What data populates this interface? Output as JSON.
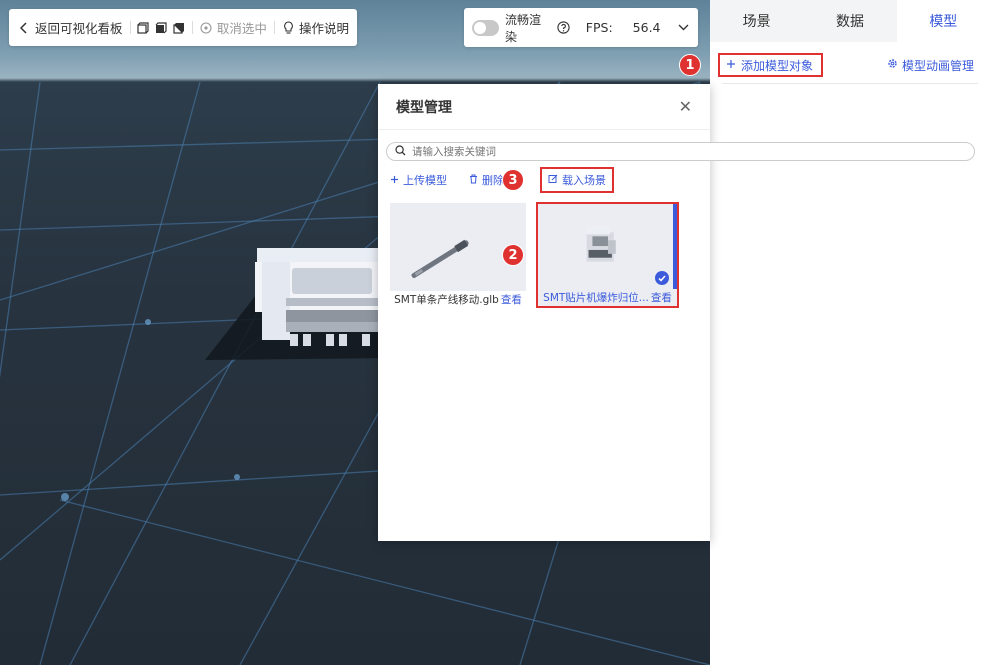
{
  "toolbar": {
    "back_label": "返回可视化看板",
    "deselect_label": "取消选中",
    "help_label": "操作说明"
  },
  "fps_panel": {
    "smooth_label": "流畅渲染",
    "fps_label": "FPS:",
    "fps_value": "56.4"
  },
  "right_panel": {
    "tabs": [
      {
        "label": "场景"
      },
      {
        "label": "数据"
      },
      {
        "label": "模型"
      }
    ],
    "add_model_label": "添加模型对象",
    "anim_manage_label": "模型动画管理"
  },
  "modal": {
    "title": "模型管理",
    "search_placeholder": "请输入搜索关键词",
    "upload_label": "上传模型",
    "delete_label": "删除",
    "load_label": "载入场景",
    "models": [
      {
        "name": "SMT单条产线移动.glb",
        "view": "查看"
      },
      {
        "name": "SMT贴片机爆炸归位...",
        "view": "查看"
      }
    ]
  },
  "badges": [
    "1",
    "2",
    "3"
  ],
  "colors": {
    "accent": "#3b5bdb",
    "highlight": "#e03131"
  }
}
